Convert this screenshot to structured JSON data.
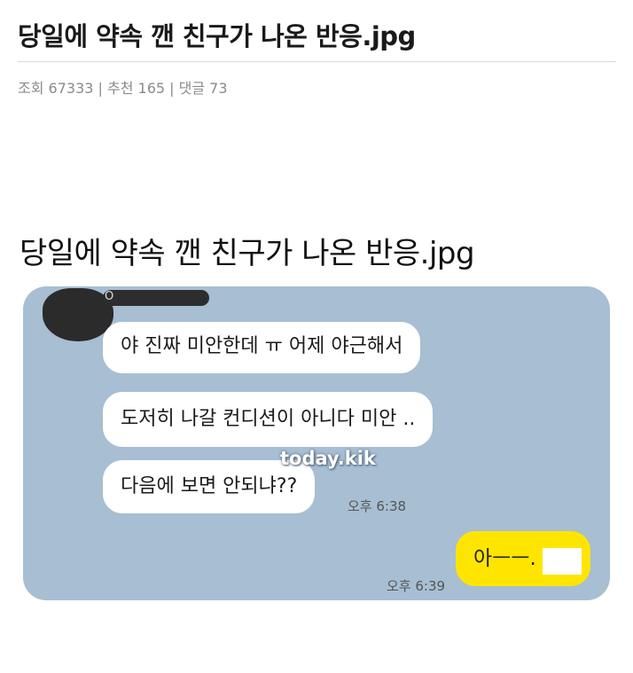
{
  "post": {
    "title": "당일에 약속 깬 친구가 나온 반응.jpg",
    "meta": "조회 67333 | 추천 165 | 댓글 73"
  },
  "image": {
    "title": "당일에 약속 깬 친구가 나온 반응.jpg",
    "sender_initial": "O",
    "messages": [
      "야 진짜 미안한데 ㅠ 어제 야근해서",
      "도저히 나갈 컨디션이 아니다 미안 ..",
      "다음에 보면 안되냐??"
    ],
    "received_time": "오후 6:38",
    "reply": "아ㅡㅡ.",
    "reply_time": "오후 6:39",
    "watermark": "today.kik"
  },
  "colors": {
    "chat_background": "#a7bed3",
    "my_bubble": "#fee500",
    "other_bubble": "#ffffff"
  }
}
